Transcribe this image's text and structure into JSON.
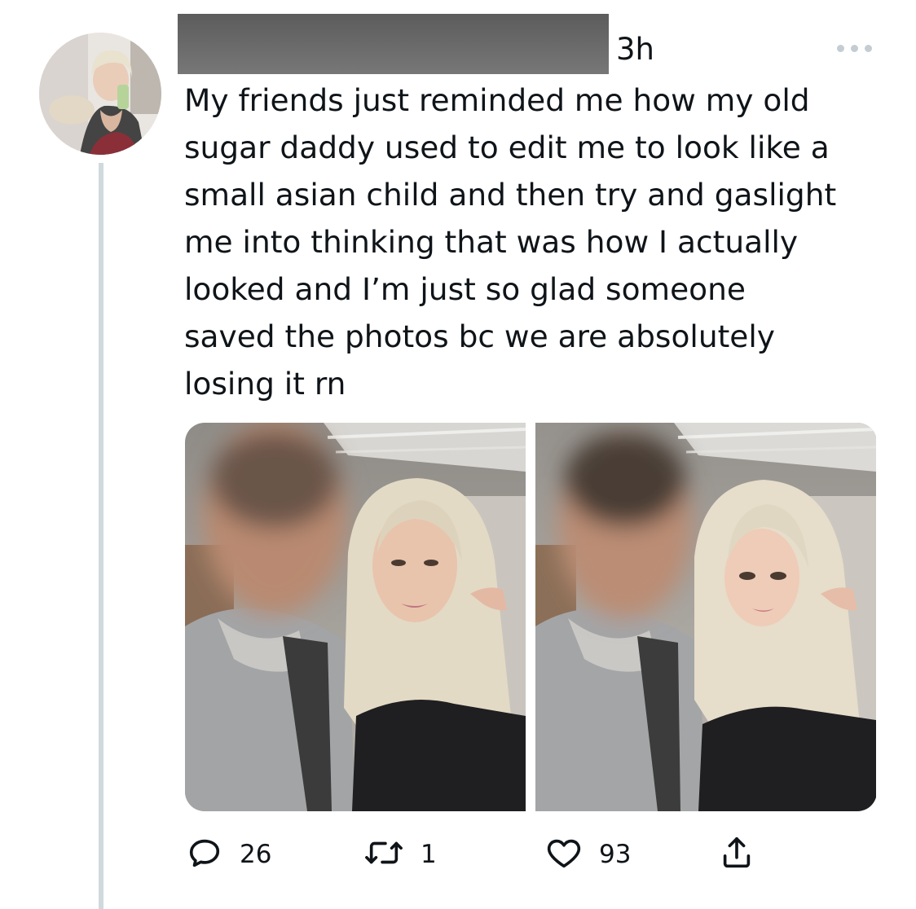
{
  "tweet": {
    "timestamp": "3h",
    "text": "My friends just reminded me how my old\nsugar daddy used to edit me to look like a\nsmall asian child and then try and gaslight\nme into thinking that was how I actually\nlooked and I’m just so glad someone\nsaved the photos bc we are absolutely\nlosing it rn"
  },
  "actions": {
    "reply_count": "26",
    "retweet_count": "1",
    "like_count": "93"
  },
  "icons": {
    "more": "more-horizontal-icon",
    "reply": "reply-icon",
    "retweet": "retweet-icon",
    "like": "heart-icon",
    "share": "share-icon"
  },
  "colors": {
    "text": "#0f1419",
    "muted": "#536471",
    "thread_line": "#cfd9de",
    "redaction": "#666666"
  }
}
